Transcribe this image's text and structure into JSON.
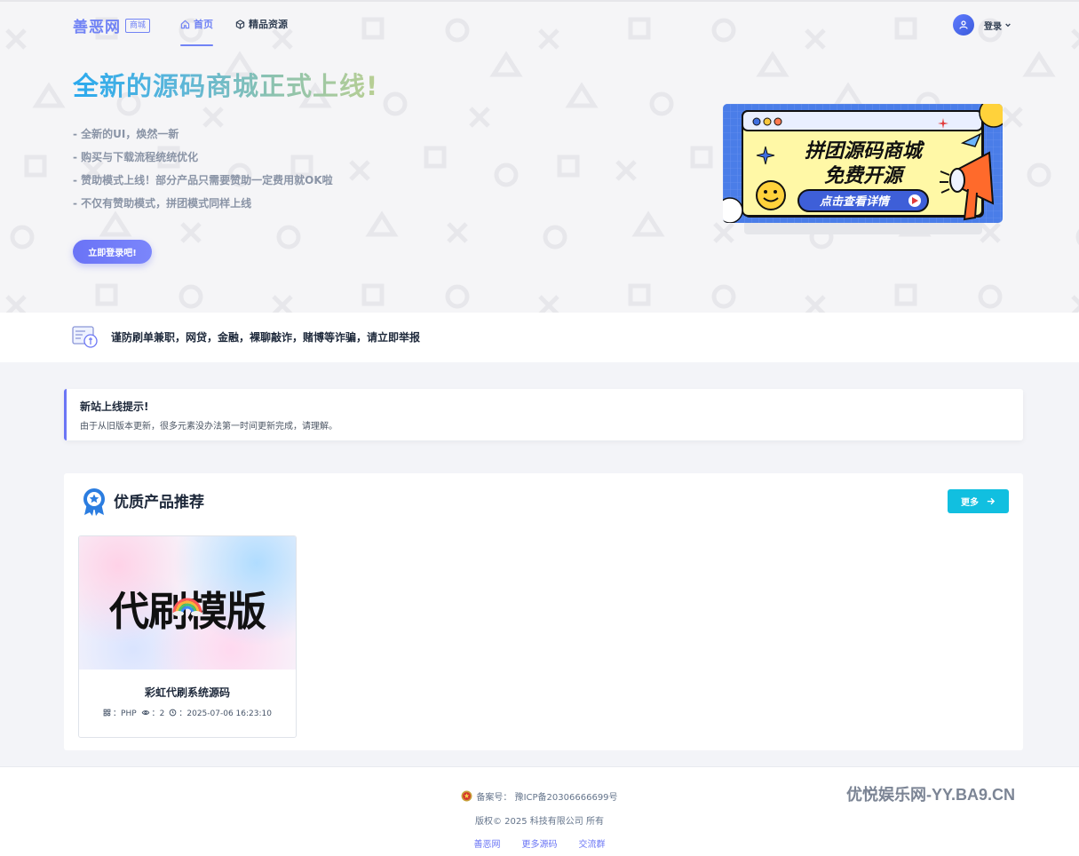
{
  "nav": {
    "brand_name": "善恶网",
    "brand_tag": "商城",
    "items": [
      {
        "label": "首页",
        "icon": "home-icon",
        "active": true
      },
      {
        "label": "精品资源",
        "icon": "cube-icon",
        "active": false
      }
    ],
    "login_label": "登录"
  },
  "hero": {
    "title": "全新的源码商城正式上线!",
    "features": [
      "- 全新的UI，焕然一新",
      "- 购买与下载流程统统优化",
      "- 赞助模式上线！部分产品只需要赞助一定费用就OK啦",
      "- 不仅有赞助模式，拼团模式同样上线"
    ],
    "cta_label": "立即登录吧!",
    "banner": {
      "line1": "拼团源码商城",
      "line2": "免费开源",
      "button": "点击查看详情"
    }
  },
  "notice": {
    "text": "谨防刷单兼职，网贷，金融，裸聊敲诈，赌博等诈骗，请立即举报"
  },
  "tip": {
    "title": "新站上线提示!",
    "body": "由于从旧版本更新，很多元素没办法第一时间更新完成，请理解。"
  },
  "products": {
    "title": "优质产品推荐",
    "more_label": "更多",
    "items": [
      {
        "thumb_text": "代刷模版",
        "title": "彩虹代刷系统源码",
        "lang_label": "：PHP",
        "views_label": "：2",
        "time_label": "：2025-07-06 16:23:10"
      }
    ]
  },
  "footer": {
    "icp": "备案号： 豫ICP备20306666699号",
    "copyright": "版权© 2025 科技有限公司 所有",
    "links": [
      "善恶网",
      "更多源码",
      "交流群"
    ],
    "watermark": "优悦娱乐网-YY.BA9.CN"
  },
  "colors": {
    "accent": "#7183f5",
    "button_cyan": "#11bfe0",
    "background": "#f3f4f8"
  }
}
